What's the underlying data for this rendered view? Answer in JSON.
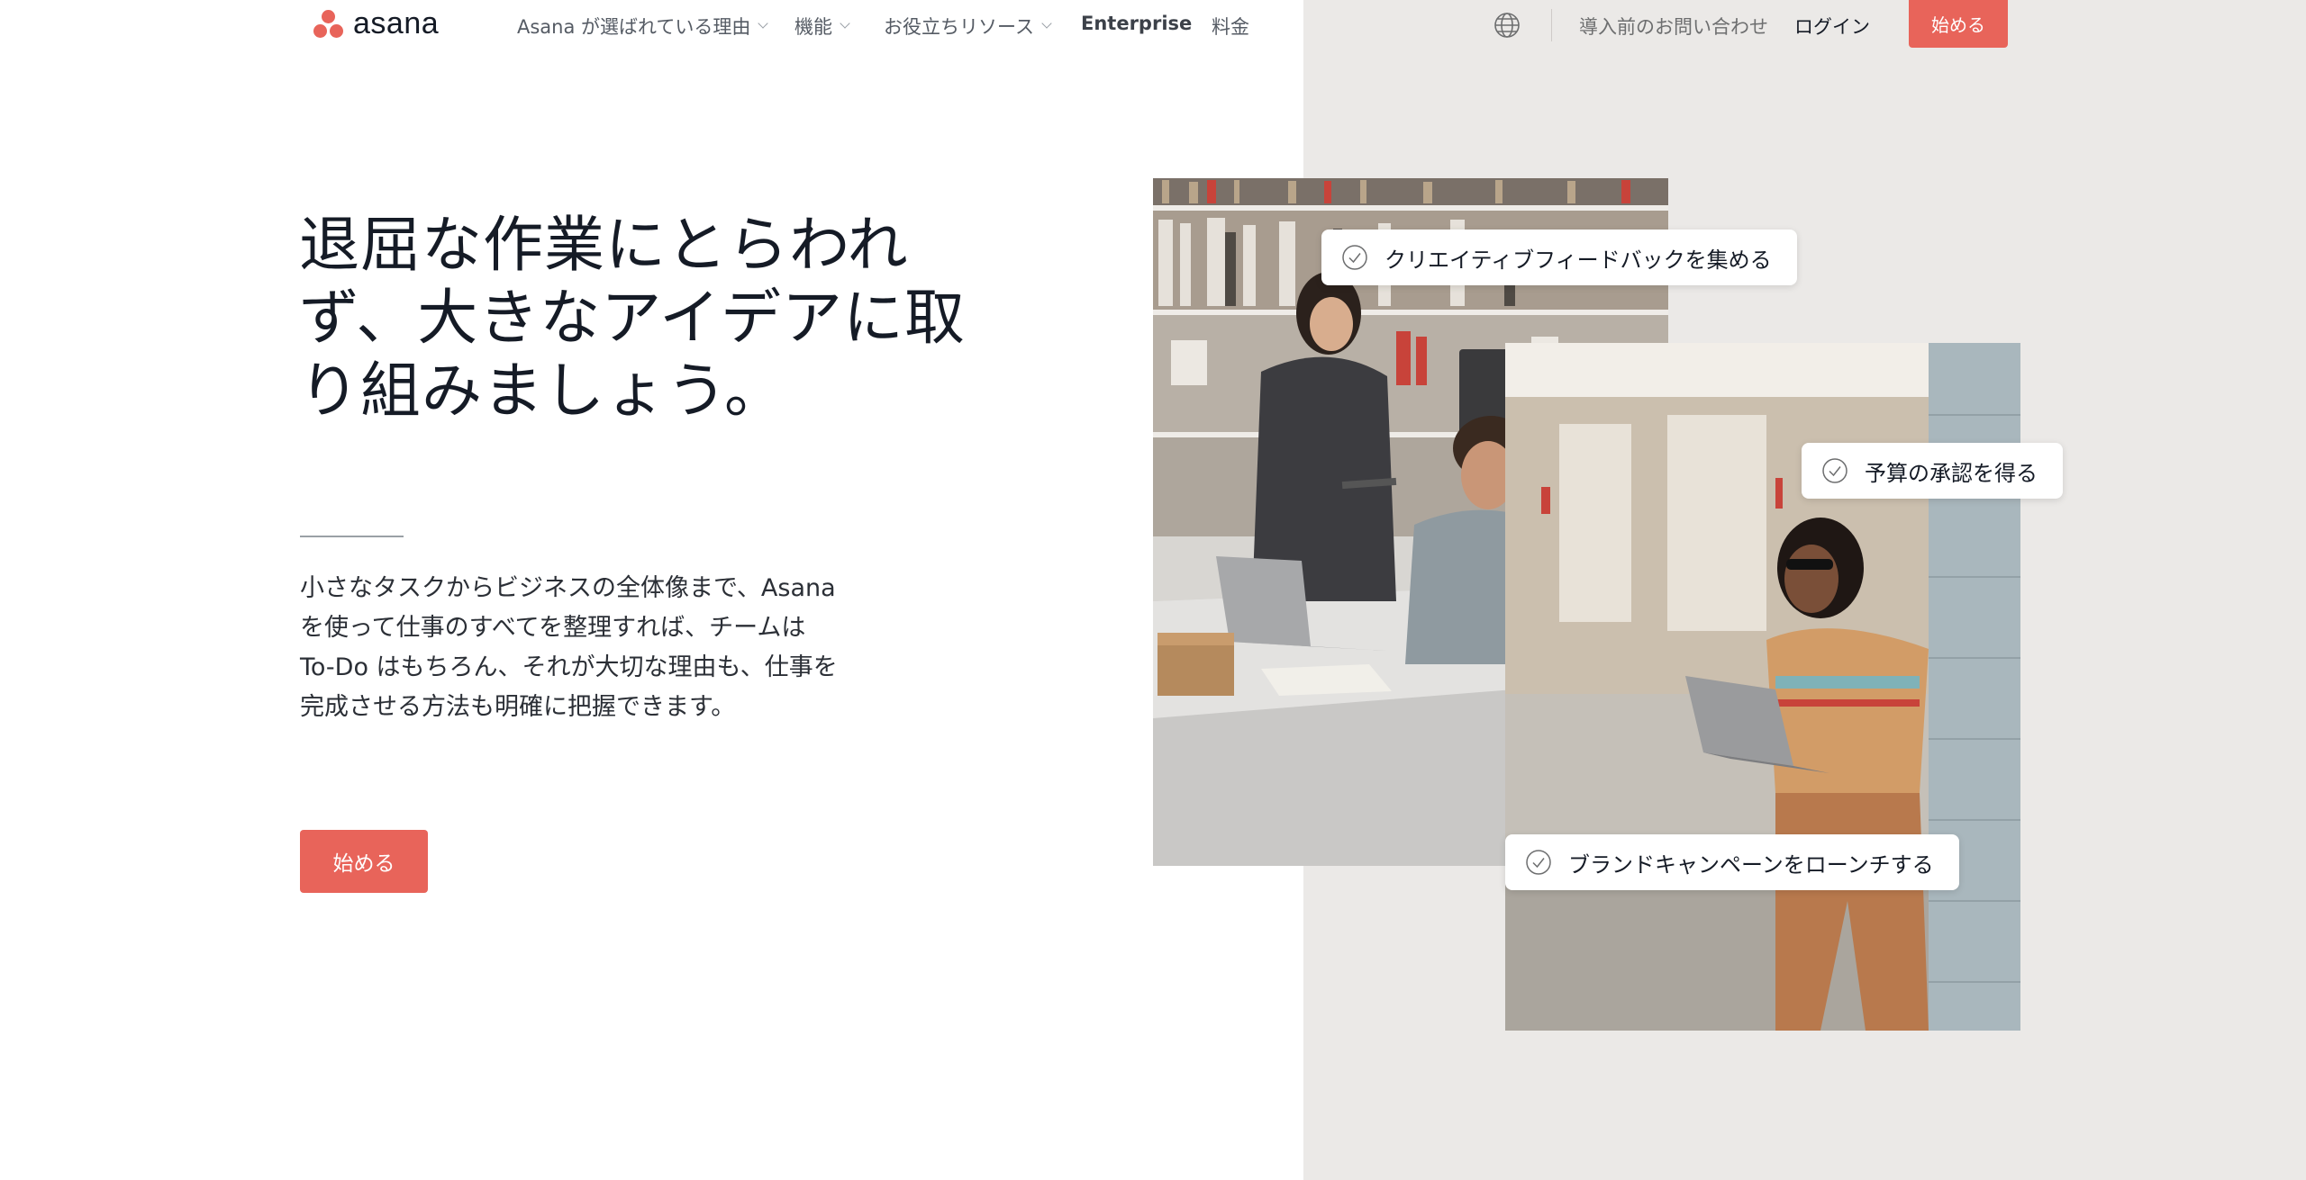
{
  "brand": {
    "name": "asana",
    "accent_color": "#e8645a",
    "right_panel_color": "#ebe9e7"
  },
  "nav": {
    "items": [
      {
        "label": "Asana が選ばれている理由",
        "has_dropdown": true
      },
      {
        "label": "機能",
        "has_dropdown": true
      },
      {
        "label": "お役立ちリソース",
        "has_dropdown": true
      },
      {
        "label": "Enterprise",
        "has_dropdown": false
      },
      {
        "label": "料金",
        "has_dropdown": false
      }
    ],
    "language_icon": "globe-icon",
    "contact": "導入前のお問い合わせ",
    "login": "ログイン",
    "cta": "始める"
  },
  "hero": {
    "title": "退屈な作業にとらわれず、大きなアイデアに取り組みましょう。",
    "body": "小さなタスクからビジネスの全体像まで、Asana を使って仕事のすべてを整理すれば、チームは To-Do はもちろん、それが大切な理由も、仕事を完成させる方法も明確に把握できます。",
    "cta": "始める"
  },
  "tasks": [
    {
      "label": "クリエイティブフィードバックを集める",
      "icon": "check-circle-icon"
    },
    {
      "label": "予算の承認を得る",
      "icon": "check-circle-icon"
    },
    {
      "label": "ブランドキャンペーンをローンチする",
      "icon": "check-circle-icon"
    }
  ]
}
